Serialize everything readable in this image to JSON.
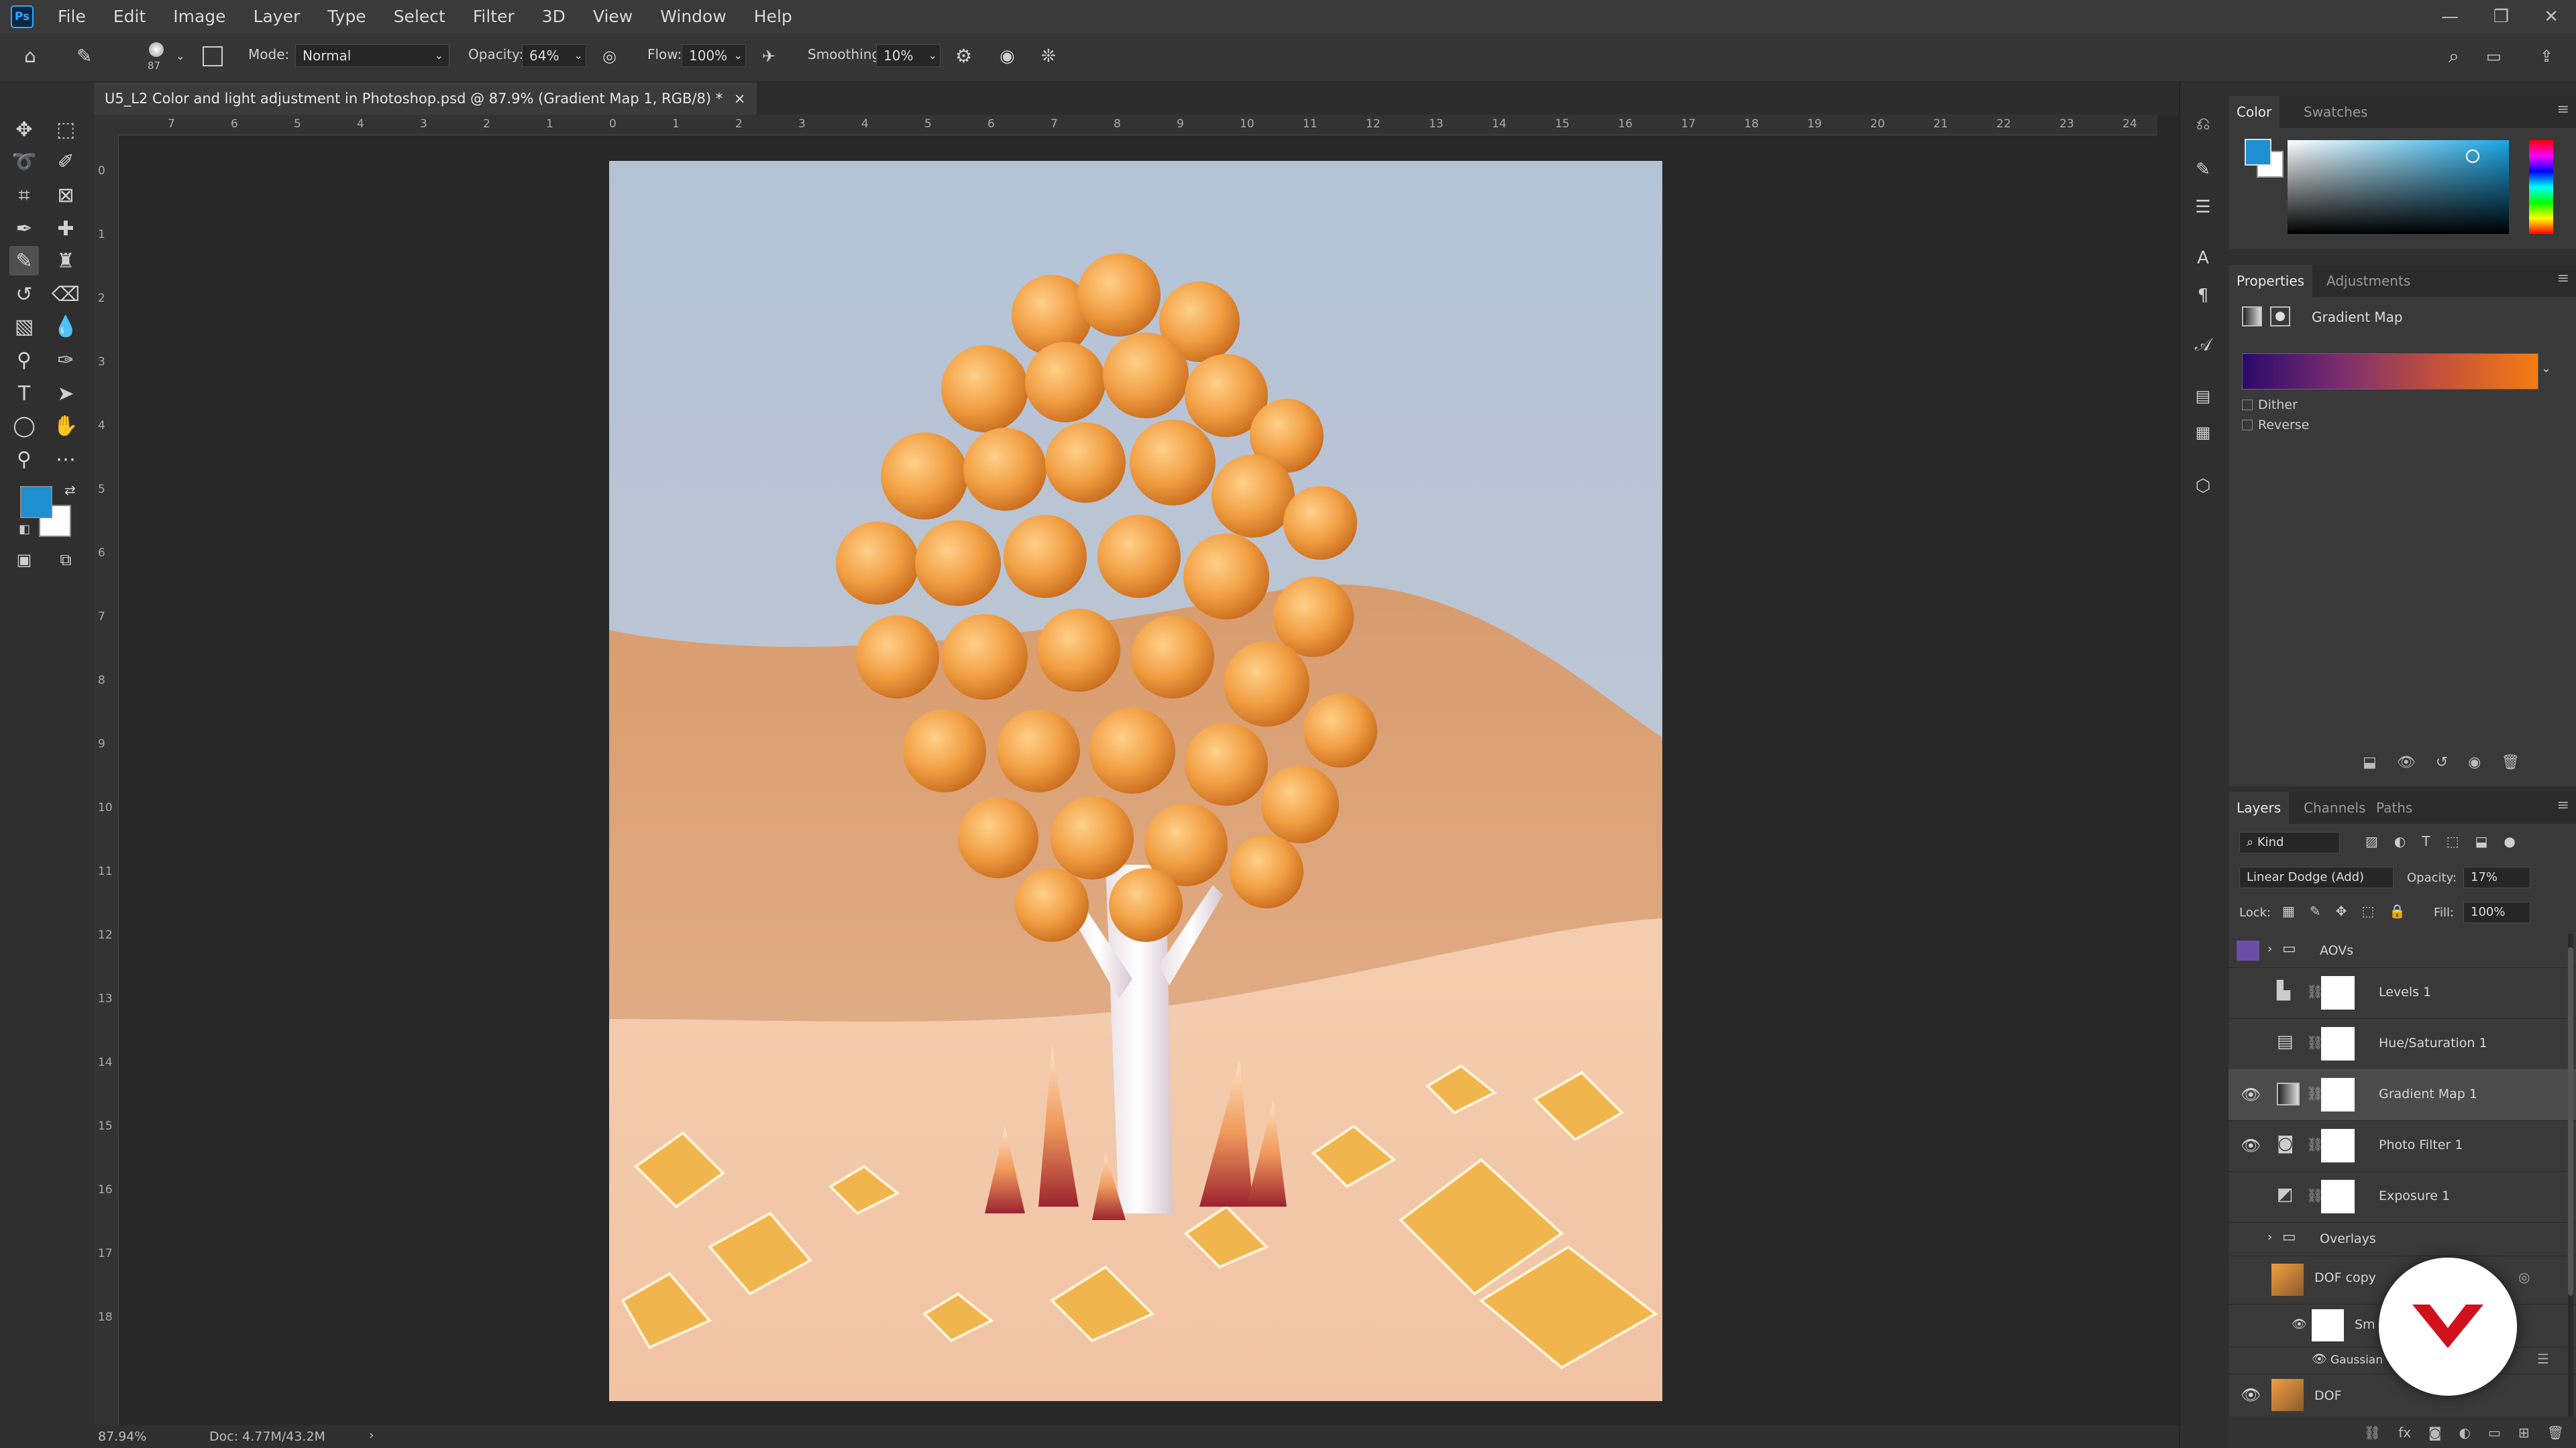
{
  "app": {
    "logo_text": "Ps"
  },
  "menubar": {
    "items": [
      "File",
      "Edit",
      "Image",
      "Layer",
      "Type",
      "Select",
      "Filter",
      "3D",
      "View",
      "Window",
      "Help"
    ]
  },
  "window_controls": {
    "minimize": "—",
    "restore": "❐",
    "close": "✕"
  },
  "options_bar": {
    "brush_size": "87",
    "mode_label": "Mode:",
    "mode_value": "Normal",
    "opacity_label": "Opacity:",
    "opacity_value": "64%",
    "flow_label": "Flow:",
    "flow_value": "100%",
    "smoothing_label": "Smoothing:",
    "smoothing_value": "10%"
  },
  "document": {
    "tab_title": "U5_L2 Color and light adjustment in Photoshop.psd @ 87.9% (Gradient Map 1, RGB/8) *",
    "close": "×"
  },
  "rulers": {
    "top": [
      "7",
      "6",
      "5",
      "4",
      "3",
      "2",
      "1",
      "0",
      "1",
      "2",
      "3",
      "4",
      "5",
      "6",
      "7",
      "8",
      "9",
      "10",
      "11",
      "12",
      "13",
      "14",
      "15",
      "16",
      "17",
      "18",
      "19",
      "20",
      "21",
      "22",
      "23",
      "24"
    ],
    "left": [
      "0",
      "1",
      "2",
      "3",
      "4",
      "5",
      "6",
      "7",
      "8",
      "9",
      "10",
      "11",
      "12",
      "13",
      "14",
      "15",
      "16",
      "17",
      "18"
    ]
  },
  "status": {
    "zoom": "87.94%",
    "doc_info": "Doc: 4.77M/43.2M",
    "arrow": "›"
  },
  "color_panel": {
    "tabs": [
      "Color",
      "Swatches"
    ],
    "active_tab": "Color"
  },
  "properties_panel": {
    "tabs": [
      "Properties",
      "Adjustments"
    ],
    "active_tab": "Properties",
    "title": "Gradient Map",
    "options": [
      {
        "label": "Dither",
        "checked": false
      },
      {
        "label": "Reverse",
        "checked": false
      }
    ],
    "gradient_start": "#2a0a6b",
    "gradient_end": "#f57c12"
  },
  "layers_panel": {
    "tabs": [
      "Layers",
      "Channels",
      "Paths"
    ],
    "active_tab": "Layers",
    "filter_kind": "Kind",
    "blend_mode": "Linear Dodge (Add)",
    "opacity_label": "Opacity:",
    "opacity_value": "17%",
    "lock_label": "Lock:",
    "fill_label": "Fill:",
    "fill_value": "100%",
    "layers": [
      {
        "name": "AOVs",
        "type": "group",
        "visible": false
      },
      {
        "name": "Levels 1",
        "type": "adjustment",
        "icon": "levels-icon",
        "visible": false
      },
      {
        "name": "Hue/Saturation 1",
        "type": "adjustment",
        "icon": "hue-saturation-icon",
        "visible": false
      },
      {
        "name": "Gradient Map 1",
        "type": "adjustment",
        "icon": "gradient-map-icon",
        "visible": true,
        "selected": true
      },
      {
        "name": "Photo Filter 1",
        "type": "adjustment",
        "icon": "photo-filter-icon",
        "visible": true
      },
      {
        "name": "Exposure 1",
        "type": "adjustment",
        "icon": "exposure-icon",
        "visible": false
      },
      {
        "name": "Overlays",
        "type": "group",
        "visible": false
      },
      {
        "name": "DOF copy",
        "type": "pixel",
        "visible": false
      },
      {
        "name": "Sm",
        "type": "smart-filter",
        "visible": true
      },
      {
        "name": "Gaussian",
        "type": "filter",
        "visible": true
      },
      {
        "name": "DOF",
        "type": "pixel",
        "visible": true
      }
    ]
  },
  "colors": {
    "foreground": "#1e8fd0",
    "background": "#ffffff",
    "accent": "#31a8ff",
    "brand_badge": "#d0101a"
  }
}
